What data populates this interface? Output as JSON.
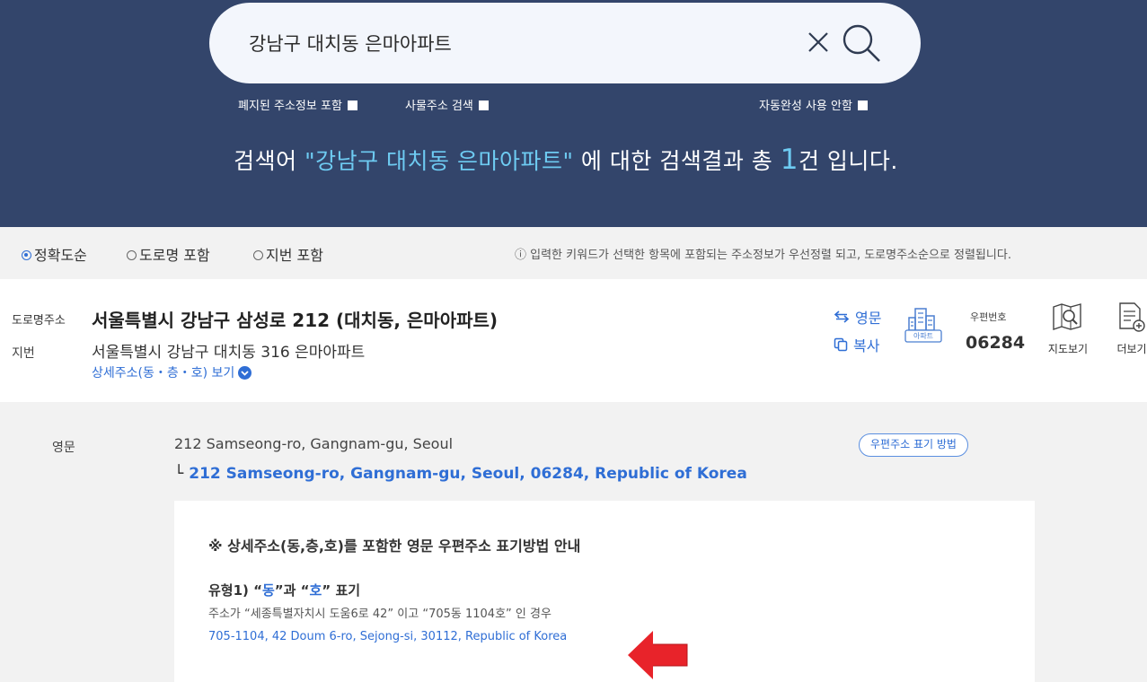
{
  "search": {
    "query": "강남구 대치동 은마아파트",
    "options": [
      {
        "label": "폐지된 주소정보 포함",
        "checked": false
      },
      {
        "label": "사물주소 검색",
        "checked": false
      },
      {
        "label": "자동완성 사용 안함",
        "checked": false
      }
    ],
    "result_prefix": "검색어 ",
    "result_keyword": "\"강남구 대치동 은마아파트\"",
    "result_middle": " 에 대한 검색결과 총 ",
    "result_count": "1",
    "result_suffix": "건 입니다."
  },
  "sort": {
    "options": [
      {
        "label": "정확도순",
        "selected": true
      },
      {
        "label": "도로명 포함",
        "selected": false
      },
      {
        "label": "지번 포함",
        "selected": false
      }
    ],
    "note": "ⓘ 입력한 키워드가 선택한 항목에 포함되는 주소정보가 우선정렬 되고, 도로명주소순으로 정렬됩니다."
  },
  "result": {
    "road_label": "도로명주소",
    "road_address": "서울특별시 강남구 삼성로 212 (대치동, 은마아파트)",
    "jibun_label": "지번",
    "jibun_address": "서울특별시 강남구 대치동 316 은마아파트",
    "detail_link": "상세주소(동・층・호) 보기",
    "english_button": "영문",
    "copy_button": "복사",
    "apt_badge": "아파트",
    "zip_label": "우편번호",
    "zip_code": "06284",
    "map_label": "지도보기",
    "more_label": "더보기"
  },
  "english": {
    "label": "영문",
    "address": "212 Samseong-ro, Gangnam-gu, Seoul",
    "corner": "└",
    "postal_format": "212 Samseong-ro, Gangnam-gu, Seoul, 06284, Republic of Korea",
    "guide_button": "우편주소 표기 방법"
  },
  "guide": {
    "title": "※ 상세주소(동,층,호)를 포함한 영문 우편주소 표기방법 안내",
    "type_prefix": "유형1) “",
    "type_dong": "동",
    "type_mid": "”과 “",
    "type_ho": "호",
    "type_suffix": "” 표기",
    "desc": "주소가 “세종특별자치시 도움6로 42” 이고 “705동 1104호” 인 경우",
    "example": "705-1104, 42 Doum 6-ro, Sejong-si, 30112, Republic of Korea"
  },
  "colors": {
    "banner": "#33456b",
    "accent": "#2f6ed5",
    "highlight": "#6ecbf2",
    "arrow": "#e8232a"
  },
  "icons": {
    "clear": "close-icon",
    "search": "search-icon",
    "swap": "swap-icon",
    "copy": "copy-icon",
    "apartment": "apartment-icon",
    "map": "map-search-icon",
    "more": "document-plus-icon",
    "arrow": "red-arrow-icon"
  }
}
